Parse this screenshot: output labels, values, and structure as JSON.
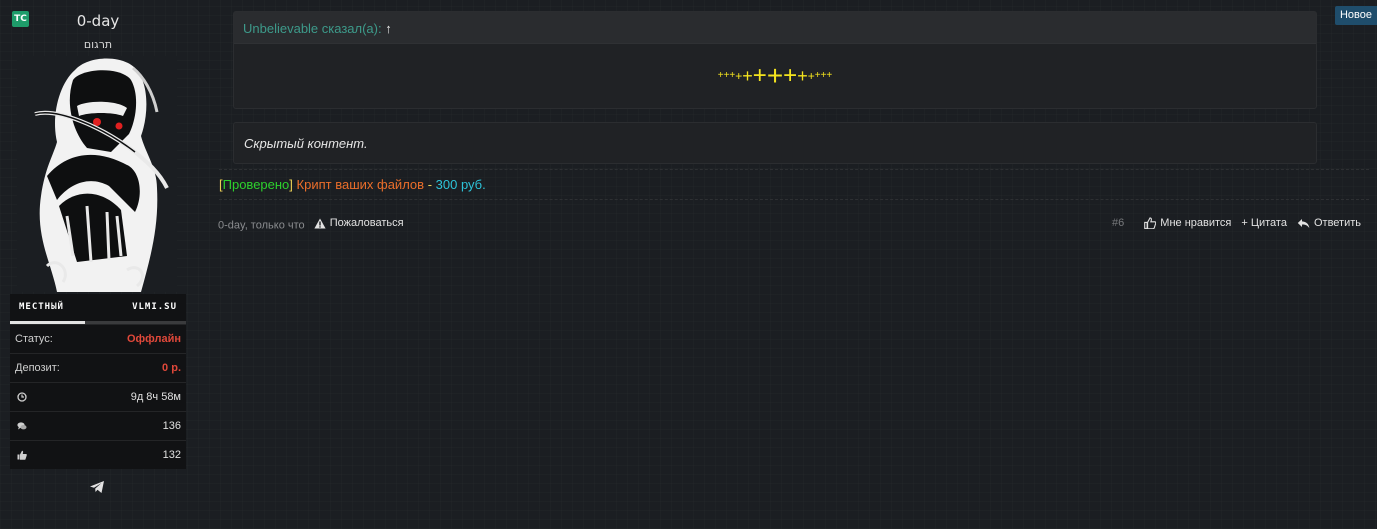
{
  "user": {
    "badge": "TC",
    "name": "0-day",
    "title": "תרגום",
    "tab_left": "МЕСТНЫЙ",
    "tab_right": "VLMI.SU",
    "rows": [
      {
        "label": "Статус:",
        "value": "Оффлайн"
      },
      {
        "label": "Депозит:",
        "value": "0 р."
      },
      {
        "icon": "clock-icon",
        "value": "9д 8ч 58м"
      },
      {
        "icon": "messages-icon",
        "value": "136"
      },
      {
        "icon": "thumbs-up-icon",
        "value": "132"
      }
    ],
    "contact_icon": "telegram-icon"
  },
  "quote": {
    "author": "Unbelievable сказал(а):",
    "arrow": "↑",
    "pluses": [
      "+",
      "+",
      "+",
      "+",
      "+",
      "+",
      "+",
      "+",
      "+",
      "+",
      "+",
      "+",
      "+"
    ]
  },
  "hidden": {
    "text": "Скрытый контент."
  },
  "signature": {
    "bracket_open": "[",
    "verified": "Проверено",
    "bracket_close": "]",
    "service": "Крипт ваших файлов",
    "dash": " - ",
    "price": "300 руб."
  },
  "footer": {
    "meta": "0-day, только что",
    "report": "Пожаловаться",
    "post_number": "#6",
    "like": "Мне нравится",
    "quote": "+ Цитата",
    "reply": "Ответить"
  },
  "new_button": "Новое",
  "colors": {
    "accent_teal": "#3d9a8a",
    "status_red": "#e0483a",
    "sig_green": "#2dd12d",
    "sig_orange": "#ea6e2a",
    "sig_cyan": "#2dc3d8",
    "plus_yellow": "#f3e31e"
  }
}
